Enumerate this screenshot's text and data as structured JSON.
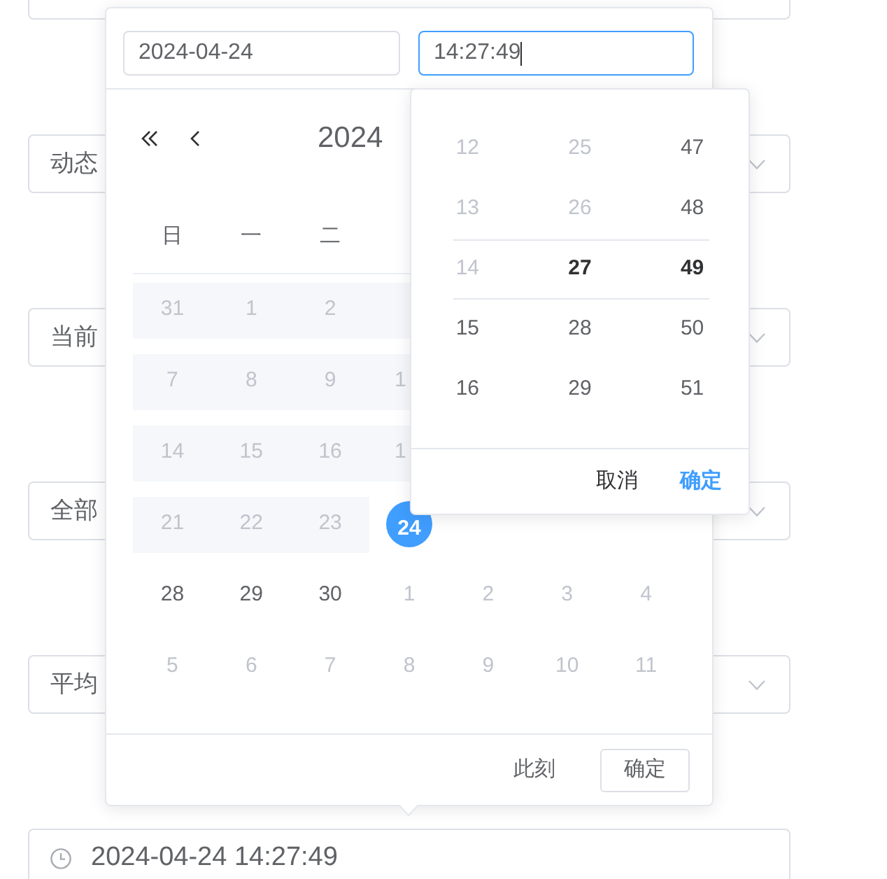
{
  "form": {
    "fields": [
      {
        "kind": "edge"
      },
      {
        "kind": "select",
        "value": "动态"
      },
      {
        "kind": "select",
        "value": "当前"
      },
      {
        "kind": "select",
        "value": "全部"
      },
      {
        "kind": "select",
        "value": "平均"
      },
      {
        "kind": "datetime",
        "value": "2024-04-24 14:27:49"
      }
    ]
  },
  "picker": {
    "date_input": {
      "value": "2024-04-24",
      "focused": false
    },
    "time_input": {
      "value": "14:27:49",
      "focused": true
    },
    "calendar": {
      "title": "2024",
      "weekdays": [
        "日",
        "一",
        "二"
      ],
      "weeks": [
        [
          {
            "text": "31",
            "kind": "disabled",
            "selected": false
          },
          {
            "text": "1",
            "kind": "disabled",
            "selected": false
          },
          {
            "text": "2",
            "kind": "disabled",
            "selected": false
          },
          {
            "kind": "disabled-edge",
            "selected": false
          }
        ],
        [
          {
            "text": "7",
            "kind": "disabled",
            "selected": false
          },
          {
            "text": "8",
            "kind": "disabled",
            "selected": false
          },
          {
            "text": "9",
            "kind": "disabled",
            "selected": false
          },
          {
            "text": "1",
            "kind": "disabled-edge",
            "selected": false
          }
        ],
        [
          {
            "text": "14",
            "kind": "disabled",
            "selected": false
          },
          {
            "text": "15",
            "kind": "disabled",
            "selected": false
          },
          {
            "text": "16",
            "kind": "disabled",
            "selected": false
          },
          {
            "text": "1",
            "kind": "disabled-edge",
            "selected": false
          }
        ],
        [
          {
            "text": "21",
            "kind": "disabled",
            "selected": false
          },
          {
            "text": "22",
            "kind": "disabled",
            "selected": false
          },
          {
            "text": "23",
            "kind": "disabled",
            "selected": false
          },
          {
            "text": "24",
            "kind": "current",
            "selected": true
          }
        ],
        [
          {
            "text": "28",
            "kind": "current",
            "selected": false
          },
          {
            "text": "29",
            "kind": "current",
            "selected": false
          },
          {
            "text": "30",
            "kind": "current",
            "selected": false
          },
          {
            "text": "1",
            "kind": "next",
            "selected": false
          },
          {
            "text": "2",
            "kind": "next",
            "selected": false
          },
          {
            "text": "3",
            "kind": "next",
            "selected": false
          },
          {
            "text": "4",
            "kind": "next",
            "selected": false
          }
        ],
        [
          {
            "text": "5",
            "kind": "next",
            "selected": false
          },
          {
            "text": "6",
            "kind": "next",
            "selected": false
          },
          {
            "text": "7",
            "kind": "next",
            "selected": false
          },
          {
            "text": "8",
            "kind": "next",
            "selected": false
          },
          {
            "text": "9",
            "kind": "next",
            "selected": false
          },
          {
            "text": "10",
            "kind": "next",
            "selected": false
          },
          {
            "text": "11",
            "kind": "next",
            "selected": false
          }
        ]
      ]
    },
    "footer": {
      "now_button": "此刻",
      "confirm_button": "确定"
    }
  },
  "time_panel": {
    "columns": [
      {
        "items": [
          {
            "text": "12",
            "selected": false,
            "disabled": true
          },
          {
            "text": "13",
            "selected": false,
            "disabled": true
          },
          {
            "text": "14",
            "selected": false,
            "disabled": true
          },
          {
            "text": "15",
            "selected": false,
            "disabled": false
          },
          {
            "text": "16",
            "selected": false,
            "disabled": false
          }
        ]
      },
      {
        "items": [
          {
            "text": "25",
            "selected": false,
            "disabled": true
          },
          {
            "text": "26",
            "selected": false,
            "disabled": true
          },
          {
            "text": "27",
            "selected": true,
            "disabled": false
          },
          {
            "text": "28",
            "selected": false,
            "disabled": false
          },
          {
            "text": "29",
            "selected": false,
            "disabled": false
          }
        ]
      },
      {
        "items": [
          {
            "text": "47",
            "selected": false,
            "disabled": false
          },
          {
            "text": "48",
            "selected": false,
            "disabled": false
          },
          {
            "text": "49",
            "selected": true,
            "disabled": false
          },
          {
            "text": "50",
            "selected": false,
            "disabled": false
          },
          {
            "text": "51",
            "selected": false,
            "disabled": false
          }
        ]
      }
    ],
    "cancel_button": "取消",
    "confirm_button": "确定"
  }
}
